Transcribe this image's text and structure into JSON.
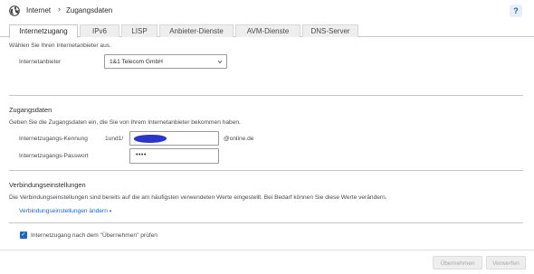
{
  "breadcrumb": {
    "icon": "globe-icon",
    "level1": "Internet",
    "separator": "›",
    "level2": "Zugangsdaten",
    "help_label": "?"
  },
  "tabs": [
    {
      "label": "Internetzugang",
      "active": true
    },
    {
      "label": "IPv6",
      "active": false
    },
    {
      "label": "LISP",
      "active": false
    },
    {
      "label": "Anbieter-Dienste",
      "active": false
    },
    {
      "label": "AVM-Dienste",
      "active": false
    },
    {
      "label": "DNS-Server",
      "active": false
    }
  ],
  "provider": {
    "intro": "Wählen Sie Ihren Internetanbieter aus.",
    "label": "Internetanbieter",
    "selected": "1&1 Telecom GmbH"
  },
  "credentials": {
    "heading": "Zugangsdaten",
    "intro": "Geben Sie die Zugangsdaten ein, die Sie von Ihrem Internetanbieter bekommen haben.",
    "login_label": "Internetzugangs-Kennung",
    "login_prefix": "1und1/",
    "login_suffix": "@online.de",
    "password_label": "Internetzugangs-Passwort",
    "password_value": "••••"
  },
  "connection": {
    "heading": "Verbindungseinstellungen",
    "intro": "Die Verbindungseinstellungen sind bereits auf die am häufigsten verwendeten Werte eingestellt. Bei Bedarf können Sie diese Werte verändern.",
    "change_link": "Verbindungseinstellungen ändern",
    "change_link_arrow": "▾"
  },
  "check": {
    "checked": true,
    "mark": "✓",
    "label": "Internetzugang nach dem \"Übernehmen\" prüfen"
  },
  "buttons": {
    "apply": "Übernehmen",
    "discard": "Verwerfen"
  },
  "colors": {
    "accent": "#1a66c9",
    "scribble": "#2b35c9",
    "disabled_text": "#a8a8a8"
  }
}
